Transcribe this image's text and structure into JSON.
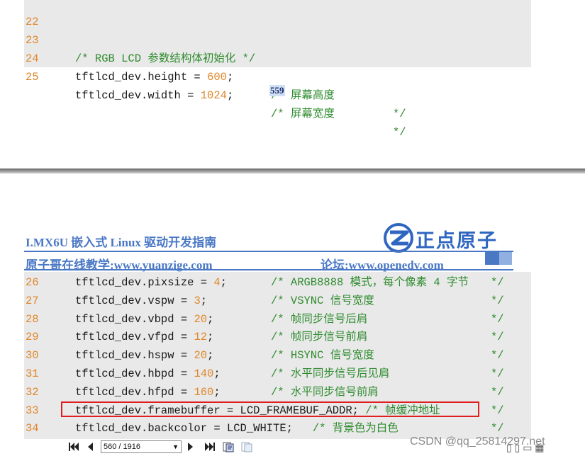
{
  "top_code": {
    "lines": [
      {
        "n": "22",
        "code": "",
        "cmt": "",
        "cmt_end": ""
      },
      {
        "n": "23",
        "code": "",
        "cmt": "/* RGB LCD 参数结构体初始化 */",
        "cmt_end": ""
      },
      {
        "n": "24",
        "code": "tftlcd_dev.height = ",
        "val": "600",
        "tail": ";",
        "cmt": "/* 屏幕高度",
        "cmt_end": "*/"
      },
      {
        "n": "25",
        "code": "tftlcd_dev.width = ",
        "val": "1024",
        "tail": ";",
        "cmt": "/* 屏幕宽度",
        "cmt_end": "*/"
      }
    ]
  },
  "page_number": "559",
  "header": {
    "title": "I.MX6U 嵌入式 Linux 驱动开发指南",
    "logo_text": "正点原子",
    "subtitle_left": "原子哥在线教学:www.yuanzige.com",
    "subtitle_right": "论坛:www.openedv.com"
  },
  "bottom_code": {
    "lines": [
      {
        "n": "26",
        "code": "tftlcd_dev.pixsize = ",
        "val": "4",
        "tail": ";",
        "cmt": "/* ARGB8888 模式，每个像素 4 字节",
        "cmt_end": "*/"
      },
      {
        "n": "27",
        "code": "tftlcd_dev.vspw = ",
        "val": "3",
        "tail": ";",
        "cmt": "/* VSYNC 信号宽度",
        "cmt_end": "*/"
      },
      {
        "n": "28",
        "code": "tftlcd_dev.vbpd = ",
        "val": "20",
        "tail": ";",
        "cmt": "/* 帧同步信号后肩",
        "cmt_end": "*/"
      },
      {
        "n": "29",
        "code": "tftlcd_dev.vfpd = ",
        "val": "12",
        "tail": ";",
        "cmt": "/* 帧同步信号前肩",
        "cmt_end": "*/"
      },
      {
        "n": "30",
        "code": "tftlcd_dev.hspw = ",
        "val": "20",
        "tail": ";",
        "cmt": "/* HSYNC 信号宽度",
        "cmt_end": "*/"
      },
      {
        "n": "31",
        "code": "tftlcd_dev.hbpd = ",
        "val": "140",
        "tail": ";",
        "cmt": "/* 水平同步信号后见肩",
        "cmt_end": "*/"
      },
      {
        "n": "32",
        "code": "tftlcd_dev.hfpd = ",
        "val": "160",
        "tail": ";",
        "cmt": "/* 水平同步信号前肩",
        "cmt_end": "*/"
      },
      {
        "n": "33",
        "code": "tftlcd_dev.framebuffer = LCD_FRAMEBUF_ADDR; ",
        "val": "",
        "tail": "",
        "cmt": "/* 帧缓冲地址",
        "cmt_end": "*/"
      },
      {
        "n": "34",
        "code": "tftlcd_dev.backcolor = LCD_WHITE;   ",
        "val": "",
        "tail": "",
        "cmt": "/* 背景色为白色",
        "cmt_end": "*/"
      }
    ]
  },
  "toolbar": {
    "first_page_icon": "first-page-icon",
    "prev_page_icon": "prev-page-icon",
    "page_value": "560 / 1916",
    "next_page_icon": "next-page-icon",
    "last_page_icon": "last-page-icon"
  },
  "watermark": "CSDN @qq_25814297.net"
}
